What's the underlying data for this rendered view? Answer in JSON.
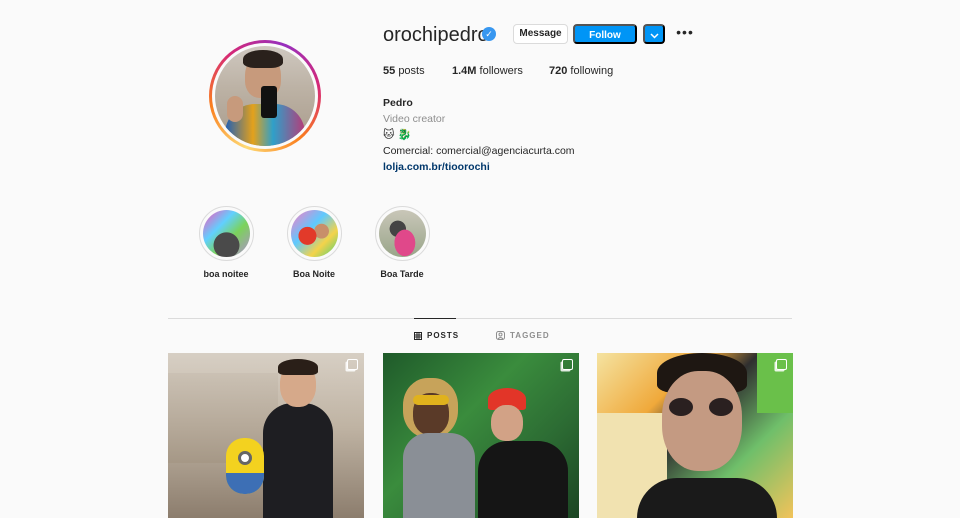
{
  "profile": {
    "username": "orochipedro",
    "verified": true,
    "buttons": {
      "message": "Message",
      "follow": "Follow"
    },
    "stats": {
      "posts": {
        "count": "55",
        "label": "posts"
      },
      "followers": {
        "count": "1.4M",
        "label": "followers"
      },
      "following": {
        "count": "720",
        "label": "following"
      }
    },
    "bio": {
      "name": "Pedro",
      "category": "Video creator",
      "emojis": "🐱 🐉",
      "contact": "Comercial: comercial@agenciacurta.com",
      "link": "lolja.com.br/tioorochi"
    }
  },
  "highlights": [
    {
      "label": "boa noitee"
    },
    {
      "label": "Boa Noite"
    },
    {
      "label": "Boa Tarde"
    }
  ],
  "tabs": [
    {
      "label": "POSTS",
      "active": true,
      "icon": "grid-icon"
    },
    {
      "label": "TAGGED",
      "active": false,
      "icon": "tag-icon"
    }
  ],
  "posts": [
    {
      "kind": "photo",
      "multiple": true
    },
    {
      "kind": "photo",
      "multiple": true
    },
    {
      "kind": "photo",
      "multiple": true
    }
  ],
  "colors": {
    "accent": "#0095f6",
    "verified": "#3897f0",
    "link": "#00376b",
    "muted": "#8e8e8e"
  }
}
